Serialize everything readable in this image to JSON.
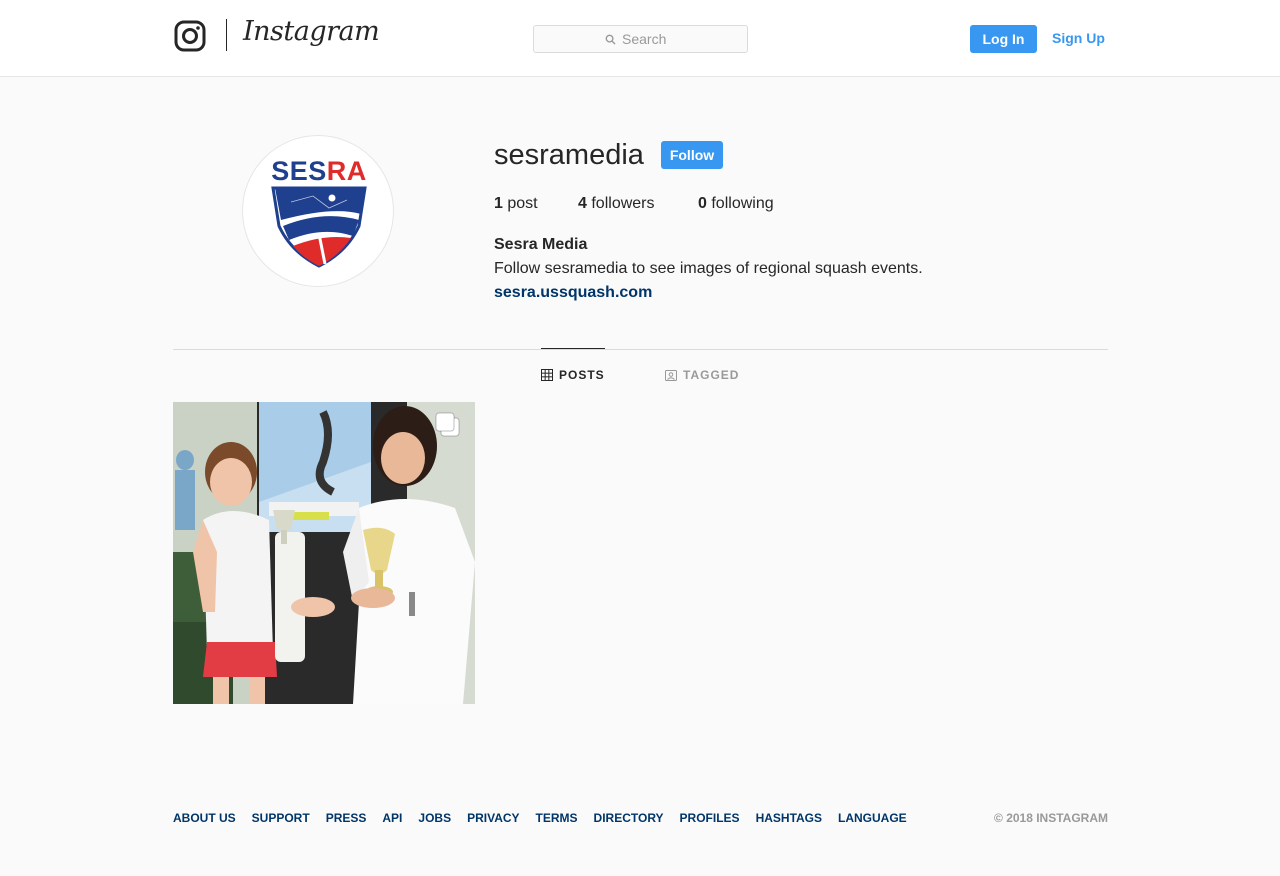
{
  "header": {
    "wordmark": "Instagram",
    "search": {
      "placeholder": "Search"
    },
    "login_label": "Log In",
    "signup_label": "Sign Up"
  },
  "profile": {
    "username": "sesramedia",
    "follow_label": "Follow",
    "avatar_text": "SESRA",
    "stats": [
      {
        "count": "1",
        "label": "post"
      },
      {
        "count": "4",
        "label": "followers"
      },
      {
        "count": "0",
        "label": "following"
      }
    ],
    "full_name": "Sesra Media",
    "bio": "Follow sesramedia to see images of regional squash events.",
    "website": "sesra.ussquash.com"
  },
  "tabs": [
    {
      "label": "POSTS",
      "active": true,
      "icon": "grid-icon"
    },
    {
      "label": "TAGGED",
      "active": false,
      "icon": "tagged-icon"
    }
  ],
  "posts": [
    {
      "type": "carousel",
      "icon": "multiple-images-icon"
    }
  ],
  "footer": {
    "links": [
      "ABOUT US",
      "SUPPORT",
      "PRESS",
      "API",
      "JOBS",
      "PRIVACY",
      "TERMS",
      "DIRECTORY",
      "PROFILES",
      "HASHTAGS",
      "LANGUAGE"
    ],
    "copyright": "© 2018 INSTAGRAM"
  },
  "colors": {
    "accent": "#3897f0",
    "link": "#003569",
    "background": "#fafafa",
    "sesra_red": "#e02b2b",
    "sesra_blue": "#1f3f8f"
  }
}
